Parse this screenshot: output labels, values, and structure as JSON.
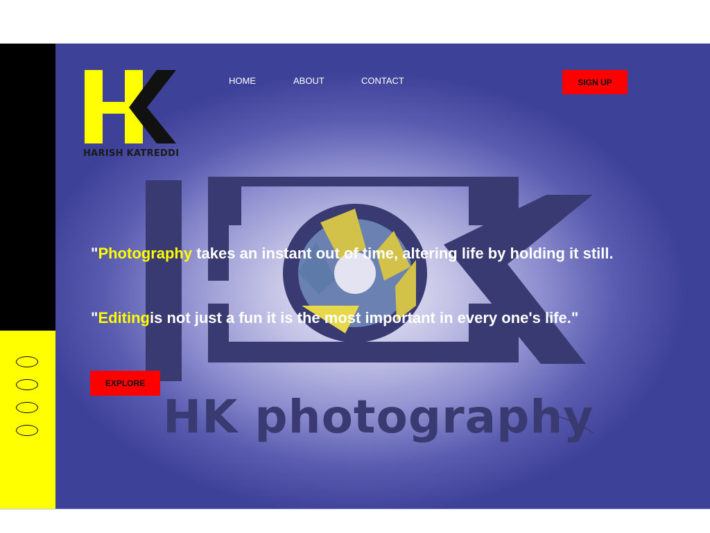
{
  "brand": {
    "logo_caption": "HARISH KATREDDI",
    "background_wordmark": "HK photography"
  },
  "nav": {
    "items": [
      "HOME",
      "ABOUT",
      "CONTACT"
    ],
    "signup_label": "SIGN UP"
  },
  "hero": {
    "quote1": {
      "prefix": "\"",
      "highlight": "Photography",
      "rest": " takes an instant out of time, altering life by holding it still."
    },
    "quote2": {
      "prefix": "\"",
      "highlight": "Editing",
      "rest": "is not just a fun it is the most important in every one's life.\""
    },
    "explore_label": "EXPLORE"
  },
  "sidebar": {
    "dot_count": 4
  },
  "colors": {
    "accent": "#ffff00",
    "button": "#ff0000",
    "hero_dark": "#3e4198",
    "sidebar_top": "#000000",
    "sidebar_bottom": "#ffff00"
  }
}
